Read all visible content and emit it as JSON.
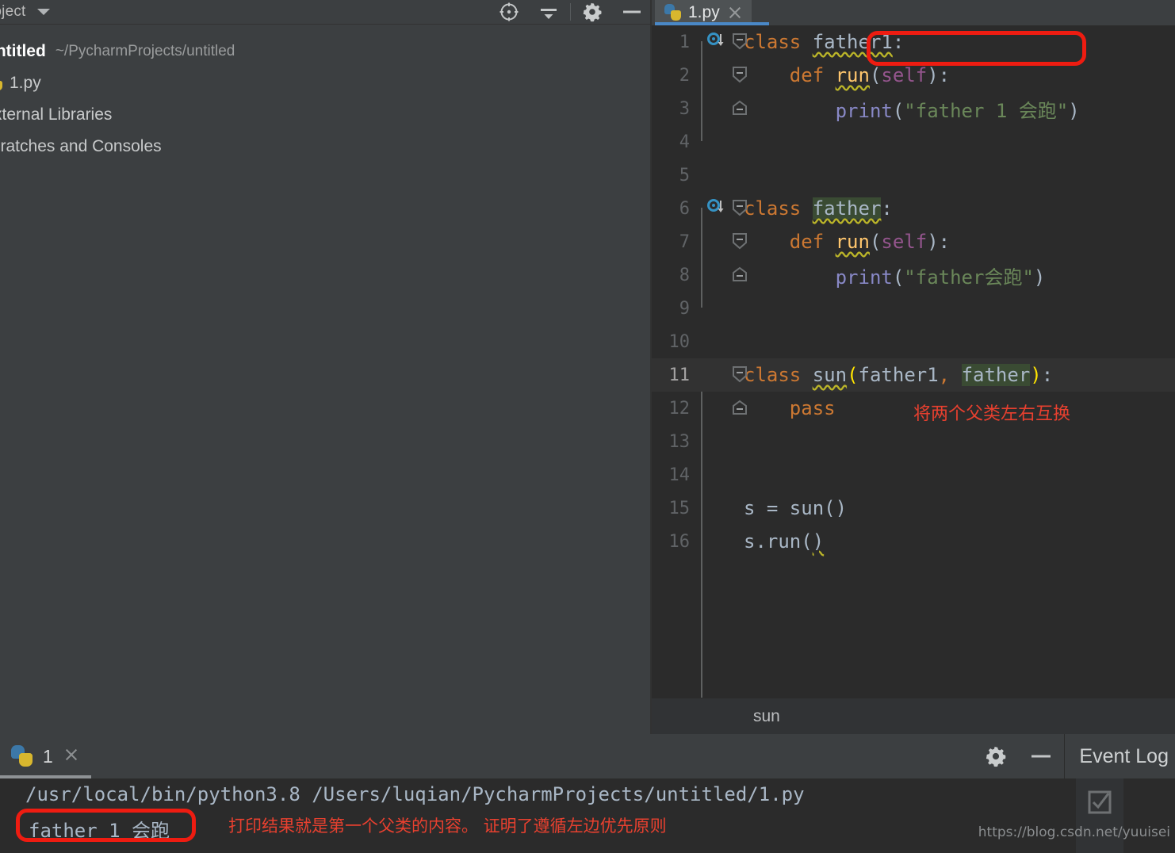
{
  "toolbar": {
    "title": "Project",
    "icons": [
      {
        "name": "locate-target-icon",
        "glyph": "crosshair"
      },
      {
        "name": "collapse-all-icon",
        "glyph": "collapse"
      },
      {
        "name": "settings-gear-icon",
        "glyph": "gear"
      },
      {
        "name": "hide-panel-icon",
        "glyph": "minus"
      }
    ]
  },
  "project_tree": {
    "items": [
      {
        "name": "project-root",
        "label": "untitled",
        "path": "~/PycharmProjects/untitled",
        "icon": "folder-icon",
        "bold": true
      },
      {
        "name": "file-1py",
        "label": "1.py",
        "path": "",
        "icon": "python-file-icon",
        "bold": false
      },
      {
        "name": "external-libraries",
        "label": "External Libraries",
        "path": "",
        "icon": "library-icon",
        "bold": false
      },
      {
        "name": "scratches-and-consoles",
        "label": "Scratches and Consoles",
        "path": "",
        "icon": "scratch-icon",
        "bold": false
      }
    ]
  },
  "editor": {
    "tab": {
      "label": "1.py",
      "icon": "python-file-icon",
      "close": "×"
    },
    "breadcrumb": "sun",
    "current_line": 11,
    "lines": [
      {
        "n": 1,
        "marker": "implemented-by-icon",
        "fold": "start",
        "text": "class father1:"
      },
      {
        "n": 2,
        "marker": "",
        "fold": "mid",
        "text": "    def run(self):"
      },
      {
        "n": 3,
        "marker": "",
        "fold": "end",
        "text": "        print(\"father 1 会跑\")"
      },
      {
        "n": 4,
        "marker": "",
        "fold": "",
        "text": ""
      },
      {
        "n": 5,
        "marker": "",
        "fold": "",
        "text": ""
      },
      {
        "n": 6,
        "marker": "implemented-by-icon",
        "fold": "start",
        "text": "class father:"
      },
      {
        "n": 7,
        "marker": "",
        "fold": "mid",
        "text": "    def run(self):"
      },
      {
        "n": 8,
        "marker": "",
        "fold": "end",
        "text": "        print(\"father会跑\")"
      },
      {
        "n": 9,
        "marker": "",
        "fold": "",
        "text": ""
      },
      {
        "n": 10,
        "marker": "",
        "fold": "",
        "text": ""
      },
      {
        "n": 11,
        "marker": "",
        "fold": "start",
        "text": "class sun(father1, father):"
      },
      {
        "n": 12,
        "marker": "",
        "fold": "end",
        "text": "    pass"
      },
      {
        "n": 13,
        "marker": "",
        "fold": "",
        "text": ""
      },
      {
        "n": 14,
        "marker": "",
        "fold": "",
        "text": ""
      },
      {
        "n": 15,
        "marker": "",
        "fold": "",
        "text": "s = sun()"
      },
      {
        "n": 16,
        "marker": "",
        "fold": "",
        "text": "s.run()"
      }
    ]
  },
  "annotations": {
    "code_note": "将两个父类左右互换",
    "console_note": "打印结果就是第一个父类的内容。 证明了遵循左边优先原则",
    "box_color": "#ee1c11",
    "text_color": "#e8402f"
  },
  "run_panel": {
    "tab_label": "1",
    "tab_icon": "python-file-icon",
    "close": "×",
    "settings_icon": "settings-gear-icon",
    "minimize_icon": "hide-panel-icon",
    "event_log_label": "Event Log",
    "console": {
      "command": "/usr/local/bin/python3.8 /Users/luqian/PycharmProjects/untitled/1.py",
      "output": "father 1 会跑"
    },
    "checkbox_icon": "checkbox-checked-icon"
  },
  "watermark": "https://blog.csdn.net/yuuisei",
  "colors": {
    "editor_bg": "#2b2b2b",
    "panel_bg": "#3c3f41",
    "tab_accent": "#4a88c7",
    "keyword": "#cc7832",
    "string": "#6a8759",
    "function": "#ffc66d",
    "self": "#94558d",
    "builtin": "#8888c6",
    "text": "#a9b7c6",
    "brace_match": "#ffe400",
    "ident_highlight": "#3a4b33"
  }
}
